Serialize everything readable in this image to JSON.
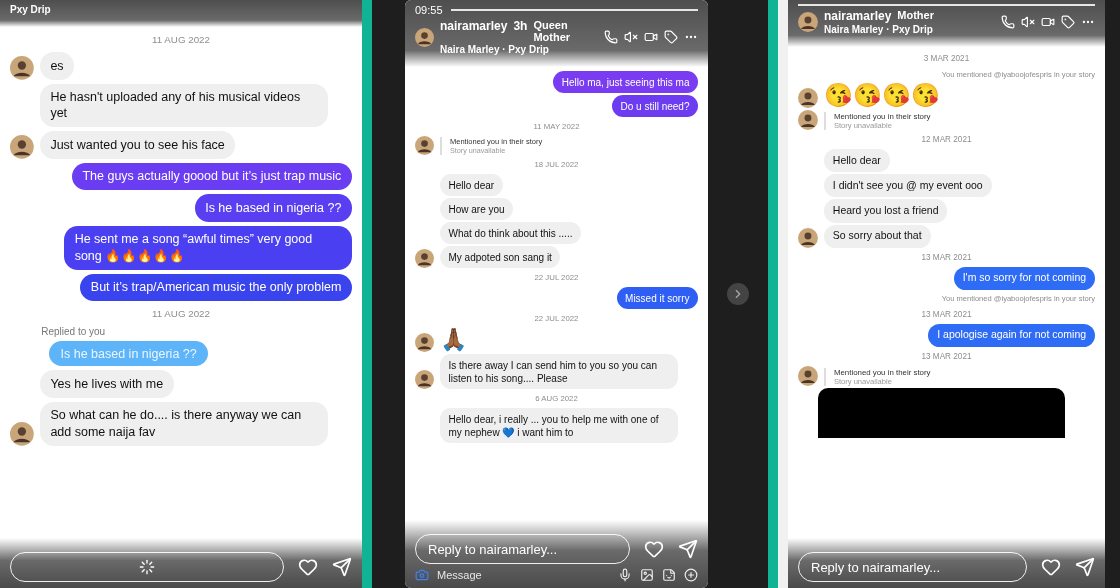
{
  "panels": [
    {
      "header": {
        "music": "Pxy Drip"
      },
      "messages": [
        {
          "kind": "date",
          "text": "11 AUG 2022"
        },
        {
          "kind": "in",
          "text": "es",
          "avatar": true
        },
        {
          "kind": "in",
          "text": "He hasn't uploaded any of his musical videos yet",
          "avatar": false
        },
        {
          "kind": "in",
          "text": "Just wanted you to see his face",
          "avatar": true
        },
        {
          "kind": "out",
          "text": "The guys actually goood but it’s just trap music",
          "color": "#6a3cf2"
        },
        {
          "kind": "out",
          "text": "Is he based in nigeria ??",
          "color": "#5a3ff2"
        },
        {
          "kind": "out",
          "text": "He sent me a song “awful times” very good song 🔥🔥🔥🔥🔥",
          "color": "#4a40f2"
        },
        {
          "kind": "out",
          "text": "But it’s trap/American music the only problem",
          "color": "#3a44ee"
        },
        {
          "kind": "date",
          "text": "11 AUG 2022"
        },
        {
          "kind": "reply",
          "label": "Replied to you",
          "text": "Is he based in nigeria ??"
        },
        {
          "kind": "in",
          "text": "Yes he lives with me",
          "avatar": false
        },
        {
          "kind": "in",
          "text": "So what can he do.... is there anyway we can add some naija fav",
          "avatar": true
        }
      ],
      "reply": {
        "loading": true
      }
    },
    {
      "status": {
        "time": "09:55"
      },
      "header": {
        "user": "nairamarley",
        "age": "3h",
        "contact": "Queen Mother",
        "music": "Naira Marley · Pxy Drip"
      },
      "messages": [
        {
          "kind": "out",
          "text": "Hello ma, just seeing this ma",
          "color": "#7a3cf0"
        },
        {
          "kind": "out",
          "text": "Do u still need?",
          "color": "#6d3cf0"
        },
        {
          "kind": "date",
          "text": "11 MAY 2022"
        },
        {
          "kind": "mention",
          "text": "Mentioned you in their story",
          "sub": "Story unavailable",
          "avatar": true
        },
        {
          "kind": "date",
          "text": "18 JUL 2022"
        },
        {
          "kind": "in",
          "text": "Hello dear",
          "avatar": false
        },
        {
          "kind": "in",
          "text": "How are you",
          "avatar": false
        },
        {
          "kind": "in",
          "text": "What do think about this .....",
          "avatar": false
        },
        {
          "kind": "in",
          "text": "My adpoted son sang it",
          "avatar": true
        },
        {
          "kind": "date",
          "text": "22 JUL 2022"
        },
        {
          "kind": "out",
          "text": "Missed it sorry",
          "color": "#2f5ef5"
        },
        {
          "kind": "date",
          "text": "22 JUL 2022"
        },
        {
          "kind": "emoji",
          "text": "🙏🏾",
          "avatar": true
        },
        {
          "kind": "in",
          "text": "Is there away I can send him to you so you can listen to his song.... Please",
          "avatar": true
        },
        {
          "kind": "date",
          "text": "6 AUG 2022"
        },
        {
          "kind": "in",
          "text": "Hello dear, i really ... you to help me with one of my nephew 💙 i want him to",
          "avatar": false
        }
      ],
      "reply": {
        "placeholder": "Reply to nairamarley...",
        "composer": "Message"
      }
    },
    {
      "header": {
        "user": "nairamarley",
        "contact": "Mother",
        "music": "Naira Marley · Pxy Drip"
      },
      "messages": [
        {
          "kind": "date",
          "text": "3 MAR 2021"
        },
        {
          "kind": "note",
          "text": "You mentioned @iyaboojofespris in your story"
        },
        {
          "kind": "emoji",
          "text": "😘😘😘😘",
          "avatar": true
        },
        {
          "kind": "mention",
          "text": "Mentioned you in their story",
          "sub": "Story unavailable",
          "avatar": true
        },
        {
          "kind": "date",
          "text": "12 MAR 2021"
        },
        {
          "kind": "in",
          "text": "Hello dear",
          "avatar": false
        },
        {
          "kind": "in",
          "text": "I didn't see you @ my event ooo",
          "avatar": false
        },
        {
          "kind": "in",
          "text": "Heard you lost a friend",
          "avatar": false
        },
        {
          "kind": "in",
          "text": "So sorry about that",
          "avatar": true
        },
        {
          "kind": "date",
          "text": "13 MAR 2021"
        },
        {
          "kind": "out",
          "text": "I'm so sorry for not coming",
          "color": "#2f6cf5"
        },
        {
          "kind": "note",
          "text": "You mentioned @iyaboojofespris in your story"
        },
        {
          "kind": "date",
          "text": "13 MAR 2021"
        },
        {
          "kind": "out",
          "text": "I apologise again for not coming",
          "color": "#2f6cf5"
        },
        {
          "kind": "date",
          "text": "13 MAR 2021"
        },
        {
          "kind": "mention",
          "text": "Mentioned you in their story",
          "sub": "Story unavailable",
          "avatar": true
        },
        {
          "kind": "media"
        }
      ],
      "reply": {
        "placeholder": "Reply to nairamarley..."
      }
    }
  ]
}
